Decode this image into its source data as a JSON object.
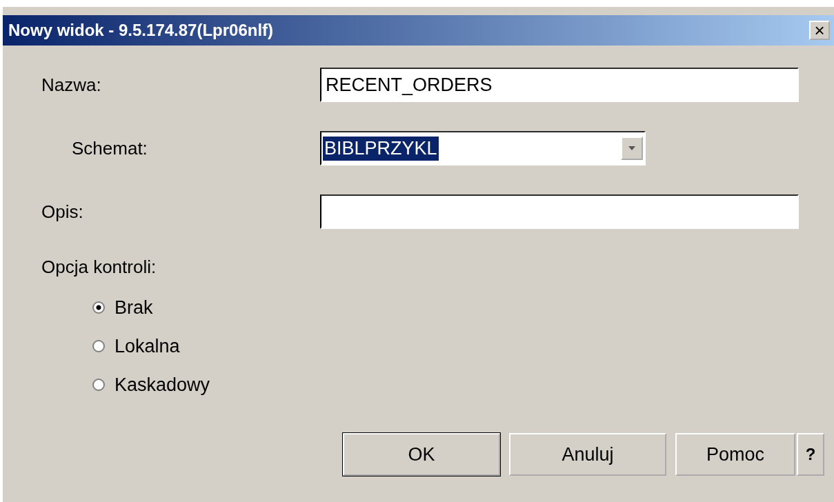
{
  "window": {
    "title": "Nowy widok - 9.5.174.87(Lpr06nlf)",
    "close": "×"
  },
  "fields": [
    {
      "kind": "text",
      "label": "Nazwa:",
      "value": "RECENT_ORDERS",
      "indented": false
    },
    {
      "kind": "select",
      "label": "Schemat:",
      "value": "BIBLPRZYKL",
      "indented": true
    },
    {
      "kind": "text",
      "label": "Opis:",
      "indented": false
    }
  ],
  "check_option": {
    "label": "Opcja kontroli:",
    "options": [
      {
        "label": "Brak",
        "selected": true
      },
      {
        "label": "Lokalna",
        "selected": false
      },
      {
        "label": "Kaskadowy",
        "selected": false
      }
    ]
  },
  "buttons": [
    {
      "label": "OK",
      "default": true
    },
    {
      "label": "Anuluj",
      "default": false
    },
    {
      "label": "Pomoc",
      "default": false
    }
  ],
  "help_button": "?"
}
